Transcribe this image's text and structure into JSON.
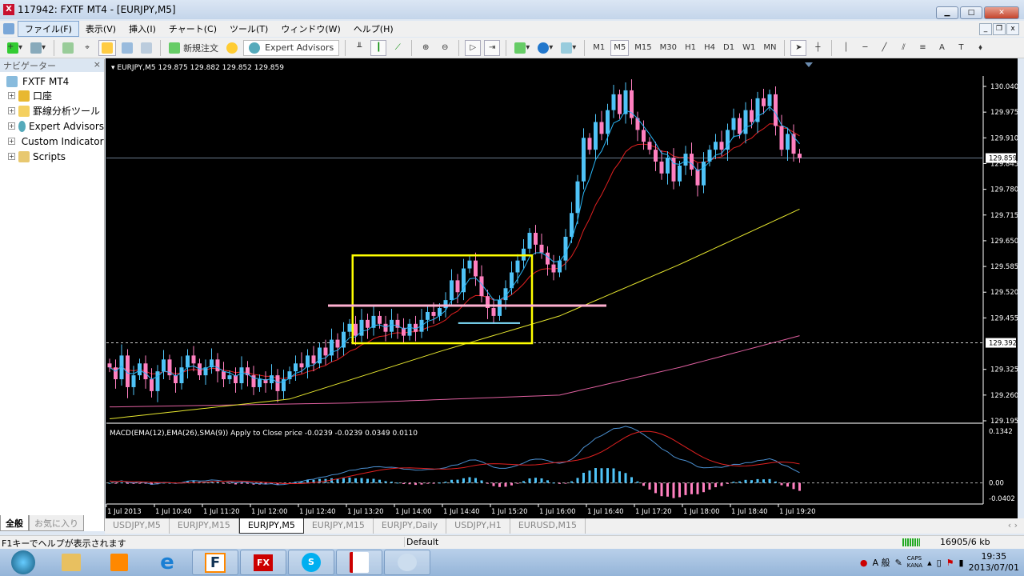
{
  "window": {
    "title": "117942: FXTF MT4 - [EURJPY,M5]"
  },
  "menu": [
    "ファイル(F)",
    "表示(V)",
    "挿入(I)",
    "チャート(C)",
    "ツール(T)",
    "ウィンドウ(W)",
    "ヘルプ(H)"
  ],
  "toolbar": {
    "new_order": "新規注文",
    "expert_advisors": "Expert Advisors",
    "timeframes": [
      "M1",
      "M5",
      "M15",
      "M30",
      "H1",
      "H4",
      "D1",
      "W1",
      "MN"
    ],
    "active_timeframe": "M5"
  },
  "navigator": {
    "title": "ナビゲーター",
    "root": "FXTF MT4",
    "items": [
      "口座",
      "罫線分析ツール",
      "Expert Advisors",
      "Custom Indicators",
      "Scripts"
    ],
    "tabs": [
      "全般",
      "お気に入り"
    ]
  },
  "chart": {
    "header": "EURJPY,M5  129.875 129.882 129.852 129.859",
    "macd_label": "MACD(EMA(12),EMA(26),SMA(9)) Apply to Close price -0.0239 -0.0239 0.0349 0.0110"
  },
  "chart_data": {
    "type": "candlestick",
    "symbol": "EURJPY",
    "timeframe": "M5",
    "price_ticks": [
      "130.040",
      "129.975",
      "129.910",
      "129.845",
      "129.780",
      "129.715",
      "129.650",
      "129.585",
      "129.520",
      "129.455",
      "129.325",
      "129.260",
      "129.195"
    ],
    "ylim": [
      129.19,
      130.07
    ],
    "current_price": "129.859",
    "marked_level": "129.392",
    "time_labels": [
      "1 Jul 2013",
      "1 Jul 10:40",
      "1 Jul 11:20",
      "1 Jul 12:00",
      "1 Jul 12:40",
      "1 Jul 13:20",
      "1 Jul 14:00",
      "1 Jul 14:40",
      "1 Jul 15:20",
      "1 Jul 16:00",
      "1 Jul 16:40",
      "1 Jul 17:20",
      "1 Jul 18:00",
      "1 Jul 18:40",
      "1 Jul 19:20"
    ],
    "closes": [
      129.33,
      129.3,
      129.36,
      129.28,
      129.31,
      129.34,
      129.3,
      129.27,
      129.32,
      129.35,
      129.31,
      129.29,
      129.33,
      129.36,
      129.34,
      129.31,
      129.33,
      129.35,
      129.32,
      129.3,
      129.31,
      129.29,
      129.33,
      129.31,
      129.28,
      129.3,
      129.29,
      129.31,
      129.27,
      129.3,
      129.32,
      129.34,
      129.33,
      129.36,
      129.34,
      129.38,
      129.36,
      129.4,
      129.38,
      129.42,
      129.44,
      129.41,
      129.45,
      129.43,
      129.46,
      129.44,
      129.42,
      129.45,
      129.43,
      129.41,
      129.44,
      129.42,
      129.45,
      129.47,
      129.46,
      129.48,
      129.5,
      129.55,
      129.52,
      129.58,
      129.6,
      129.56,
      129.51,
      129.48,
      129.46,
      129.5,
      129.53,
      129.57,
      129.6,
      129.63,
      129.67,
      129.64,
      129.62,
      129.59,
      129.57,
      129.6,
      129.66,
      129.72,
      129.8,
      129.91,
      129.88,
      129.95,
      129.92,
      129.98,
      130.02,
      129.97,
      130.03,
      129.96,
      129.93,
      129.9,
      129.88,
      129.85,
      129.82,
      129.86,
      129.8,
      129.84,
      129.87,
      129.83,
      129.79,
      129.85,
      129.88,
      129.9,
      129.88,
      129.93,
      129.96,
      129.92,
      129.98,
      129.95,
      130.01,
      129.99,
      130.02,
      129.94,
      129.88,
      129.92,
      129.87,
      129.859
    ],
    "ma_yellow": [
      [
        0,
        129.2
      ],
      [
        30,
        129.25
      ],
      [
        55,
        129.37
      ],
      [
        75,
        129.46
      ],
      [
        95,
        129.59
      ],
      [
        115,
        129.73
      ]
    ],
    "ma_pink": [
      [
        0,
        129.23
      ],
      [
        40,
        129.24
      ],
      [
        75,
        129.26
      ],
      [
        95,
        129.33
      ],
      [
        115,
        129.41
      ]
    ],
    "annotations": {
      "rectangle": {
        "bar_from": 40.5,
        "bar_to": 70.4,
        "price_top": 129.613,
        "price_bottom": 129.391
      },
      "pink_line": {
        "bar_from": 36.4,
        "bar_to": 82.8,
        "price": 129.486
      },
      "cyan_line": {
        "bar_from": 58.1,
        "bar_to": 68.4,
        "price": 129.442
      }
    },
    "macd": {
      "ticks": [
        "0.1342",
        "0.00",
        "-0.0402"
      ],
      "ylim": [
        -0.0402,
        0.1342
      ]
    },
    "colors": {
      "bull": "#4fc3f7",
      "bear": "#ff80c0",
      "ema_fast": "#29b6f6",
      "ema_slow": "#e02020",
      "ma_yellow": "#e6e62e",
      "ma_pink": "#e060a0",
      "rect": "#ffff00",
      "pink_line": "#ffb0d0",
      "cyan_line": "#80e0ff"
    }
  },
  "tabs": [
    "USDJPY,M5",
    "EURJPY,M15",
    "EURJPY,M5",
    "EURJPY,M15",
    "EURJPY,Daily",
    "USDJPY,H1",
    "EURUSD,M15"
  ],
  "active_tab": "EURJPY,M5",
  "status": {
    "help": "F1キーでヘルプが表示されます",
    "profile": "Default",
    "traffic": "16905/6 kb"
  },
  "taskbar": {
    "ime": "A 般",
    "caps": "CAPS",
    "kana": "KANA",
    "time": "19:35",
    "date": "2013/07/01"
  }
}
